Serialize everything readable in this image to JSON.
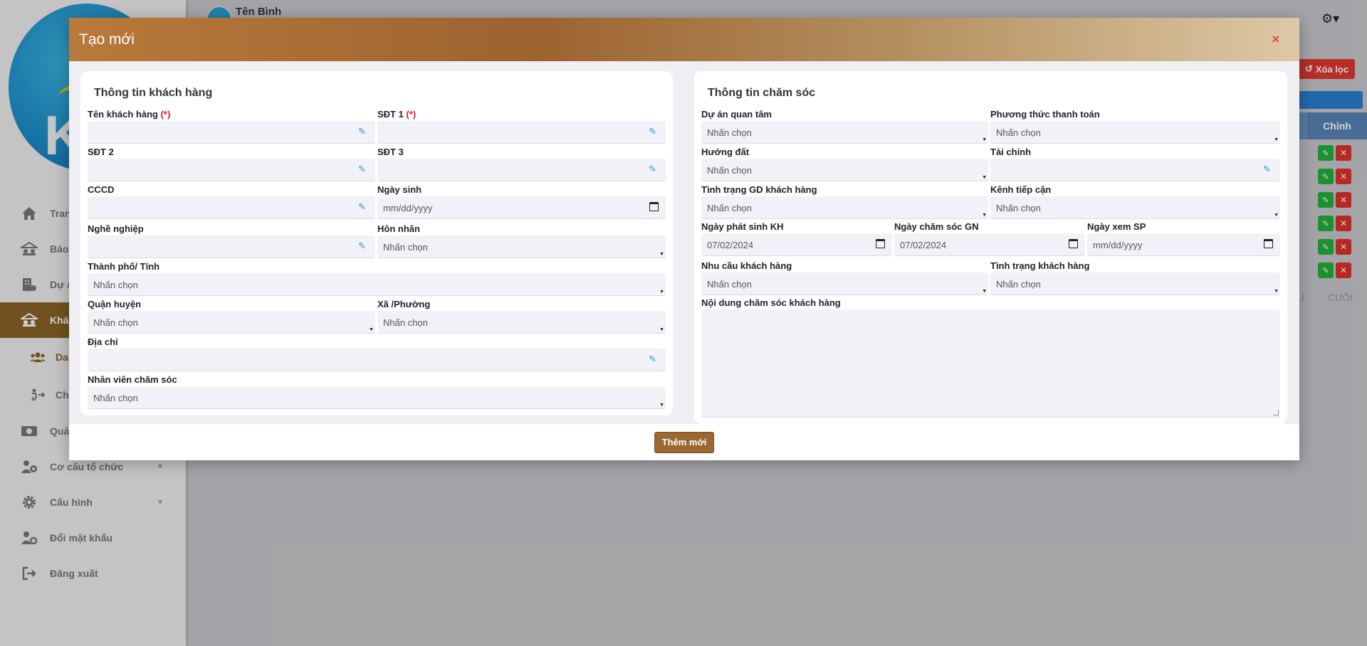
{
  "app": {
    "user_name": "Tên Bình",
    "clear_filter_label": "Xóa lọc",
    "table_edit_header": "Chỉnh",
    "pager_prev": "U",
    "pager_last": "CUỐI"
  },
  "sidebar": {
    "logo_letter": "K",
    "items": [
      {
        "label": "Tran",
        "icon": "home-icon"
      },
      {
        "label": "Báo",
        "icon": "report-icon"
      },
      {
        "label": "Dự á",
        "icon": "building-icon"
      },
      {
        "label": "Khác",
        "icon": "customer-icon",
        "active": true
      },
      {
        "label": "Dan",
        "icon": "users-icon",
        "sub": true
      },
      {
        "label": "Chă",
        "icon": "care-icon",
        "sub": true
      },
      {
        "label": "Quả",
        "icon": "money-icon"
      },
      {
        "label": "Cơ cấu tổ chức",
        "icon": "org-icon",
        "expandable": true
      },
      {
        "label": "Cấu hình",
        "icon": "gear-icon",
        "expandable": true
      },
      {
        "label": "Đổi mật khẩu",
        "icon": "user-key-icon"
      },
      {
        "label": "Đăng xuất",
        "icon": "logout-icon"
      }
    ]
  },
  "modal": {
    "title": "Tạo mới",
    "close_symbol": "×",
    "submit_label": "Thêm mới",
    "left_card": {
      "title": "Thông tin khách hàng",
      "labels": {
        "name": "Tên khách hàng",
        "phone1": "SĐT 1",
        "phone2": "SĐT 2",
        "phone3": "SĐT 3",
        "id_card": "CCCD",
        "birthday": "Ngày sinh",
        "job": "Nghề nghiệp",
        "marital": "Hôn nhân",
        "city": "Thành phố/ Tỉnh",
        "district": "Quận huyện",
        "ward": "Xã /Phường",
        "address": "Địa chỉ",
        "staff": "Nhân viên chăm sóc"
      },
      "required_mark": "(*)",
      "date_placeholder": "mm/dd/yyyy",
      "select_placeholder": "Nhấn chọn"
    },
    "right_card": {
      "title": "Thông tin chăm sóc",
      "labels": {
        "project": "Dự án quan tâm",
        "payment": "Phương thức thanh toán",
        "direction": "Hướng đất",
        "finance": "Tài chính",
        "transaction_status": "Tình trạng GD khách hàng",
        "channel": "Kênh tiếp cận",
        "arise_date": "Ngày phát sinh KH",
        "care_date": "Ngày chăm sóc GN",
        "view_date": "Ngày xem SP",
        "needs": "Nhu cầu khách hàng",
        "customer_status": "Tình trạng khách hàng",
        "care_content": "Nội dung chăm sóc khách hàng"
      },
      "values": {
        "arise_date": "07/02/2024",
        "care_date": "07/02/2024",
        "view_date": "mm/dd/yyyy"
      },
      "select_placeholder": "Nhấn chọn"
    }
  }
}
